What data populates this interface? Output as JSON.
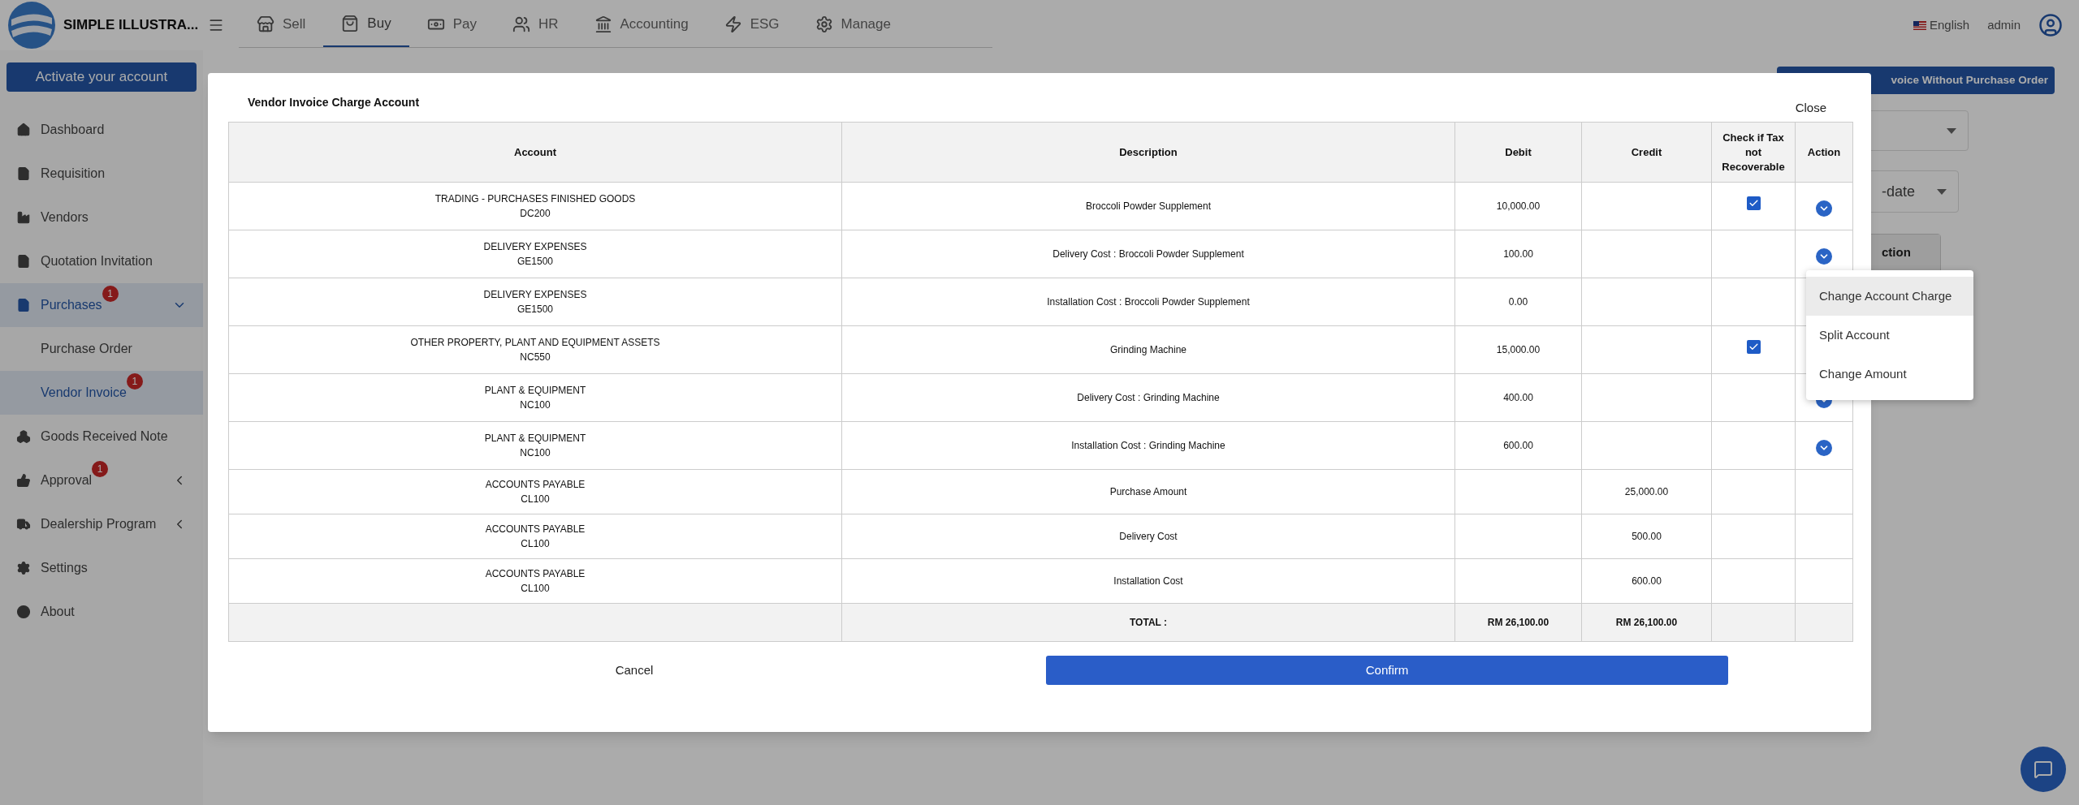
{
  "brand": {
    "name": "SIMPLE ILLUSTRA..."
  },
  "nav_tabs": [
    {
      "label": "Sell",
      "selected": false
    },
    {
      "label": "Buy",
      "selected": true
    },
    {
      "label": "Pay",
      "selected": false
    },
    {
      "label": "HR",
      "selected": false
    },
    {
      "label": "Accounting",
      "selected": false
    },
    {
      "label": "ESG",
      "selected": false
    },
    {
      "label": "Manage",
      "selected": false
    }
  ],
  "header": {
    "language": "English",
    "user": "admin"
  },
  "activate_button": "Activate your account",
  "sidebar": {
    "items": [
      {
        "label": "Dashboard",
        "selected": false
      },
      {
        "label": "Requisition",
        "selected": false
      },
      {
        "label": "Vendors",
        "selected": false
      },
      {
        "label": "Quotation Invitation",
        "selected": false
      },
      {
        "label": "Purchases",
        "selected": true,
        "badge": "1",
        "expanded": true,
        "children": [
          {
            "label": "Purchase Order",
            "selected": false
          },
          {
            "label": "Vendor Invoice",
            "selected": true,
            "badge": "1"
          }
        ]
      },
      {
        "label": "Goods Received Note",
        "selected": false
      },
      {
        "label": "Approval",
        "selected": false,
        "badge": "1",
        "expanded": false
      },
      {
        "label": "Dealership Program",
        "selected": false,
        "expanded": false
      },
      {
        "label": "Settings",
        "selected": false
      },
      {
        "label": "About",
        "selected": false
      }
    ]
  },
  "page": {
    "new_invoice_button": "voice Without Purchase Order",
    "filter_2": "-date",
    "table_header": "ction"
  },
  "modal": {
    "title": "Vendor Invoice Charge Account",
    "close": "Close",
    "columns": [
      "Account",
      "Description",
      "Debit",
      "Credit",
      "Check if Tax not Recoverable",
      "Action"
    ],
    "rows": [
      {
        "account": "TRADING - PURCHASES FINISHED GOODS",
        "code": "DC200",
        "description": "Broccoli Powder Supplement",
        "debit": "10,000.00",
        "tax_not_recoverable": true,
        "action": true
      },
      {
        "account": "DELIVERY EXPENSES",
        "code": "GE1500",
        "description": "Delivery Cost : Broccoli Powder Supplement",
        "debit": "100.00",
        "tax_not_recoverable": false,
        "action": true
      },
      {
        "account": "DELIVERY EXPENSES",
        "code": "GE1500",
        "description": "Installation Cost : Broccoli Powder Supplement",
        "debit": "0.00",
        "tax_not_recoverable": false,
        "action": false
      },
      {
        "account": "OTHER PROPERTY, PLANT AND EQUIPMENT ASSETS",
        "code": "NC550",
        "description": "Grinding Machine",
        "debit": "15,000.00",
        "tax_not_recoverable": true,
        "action": false
      },
      {
        "account": "PLANT & EQUIPMENT",
        "code": "NC100",
        "description": "Delivery Cost : Grinding Machine",
        "debit": "400.00",
        "tax_not_recoverable": false,
        "action": true
      },
      {
        "account": "PLANT & EQUIPMENT",
        "code": "NC100",
        "description": "Installation Cost : Grinding Machine",
        "debit": "600.00",
        "tax_not_recoverable": false,
        "action": true
      },
      {
        "account": "ACCOUNTS PAYABLE",
        "code": "CL100",
        "description": "Purchase Amount",
        "credit": "25,000.00",
        "tax_not_recoverable": false,
        "action": false
      },
      {
        "account": "ACCOUNTS PAYABLE",
        "code": "CL100",
        "description": "Delivery Cost",
        "credit": "500.00",
        "tax_not_recoverable": false,
        "action": false
      },
      {
        "account": "ACCOUNTS PAYABLE",
        "code": "CL100",
        "description": "Installation Cost",
        "credit": "600.00",
        "tax_not_recoverable": false,
        "action": false
      }
    ],
    "total": {
      "label": "TOTAL :",
      "debit": "RM 26,100.00",
      "credit": "RM 26,100.00"
    },
    "cancel": "Cancel",
    "confirm": "Confirm"
  },
  "action_menu": {
    "items": [
      {
        "label": "Change Account Charge",
        "selected": true
      },
      {
        "label": "Split Account",
        "selected": false
      },
      {
        "label": "Change Amount",
        "selected": false
      }
    ]
  }
}
